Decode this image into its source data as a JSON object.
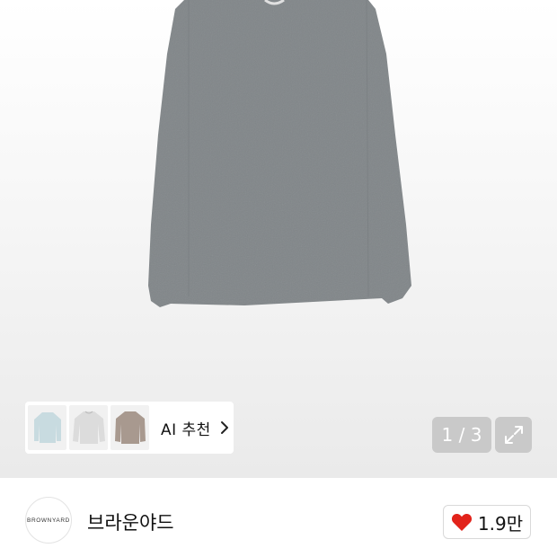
{
  "gallery": {
    "image_alt": "gray long sleeve t-shirt",
    "ai_recommend": {
      "label": "AI 추천",
      "thumbnails": [
        "light-blue-shirt-thumbnail",
        "light-gray-shirt-thumbnail",
        "brown-shirt-thumbnail"
      ]
    },
    "counter": "1 / 3"
  },
  "brand": {
    "logo_text": "BROWNYARD",
    "name": "브라운야드",
    "likes": "1.9만",
    "heart_color": "#e2231a"
  }
}
